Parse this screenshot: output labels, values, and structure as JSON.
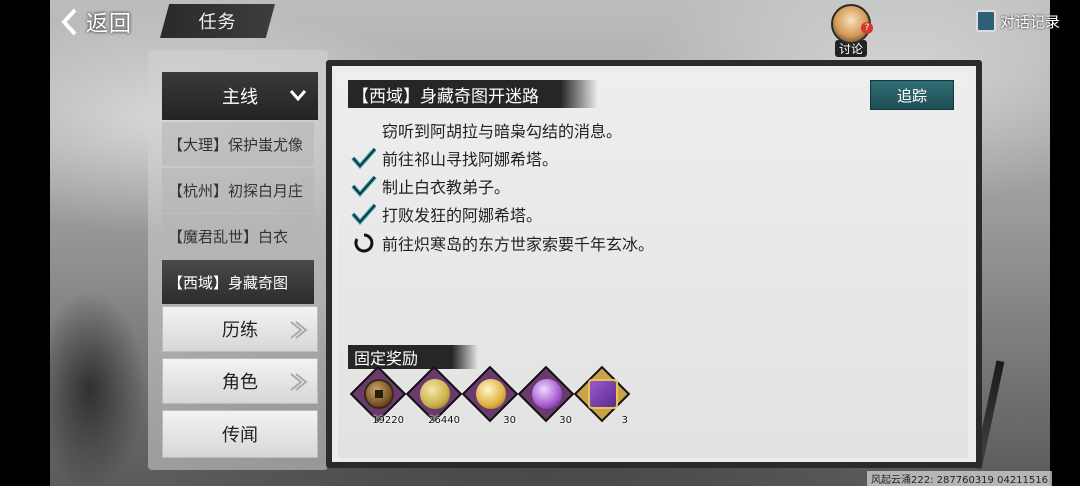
{
  "header": {
    "back_label": "返回",
    "page_title": "任务",
    "discuss_label": "讨论",
    "discuss_badge": "?",
    "dialog_log_label": "对话记录"
  },
  "nav": {
    "main_label": "主线",
    "quests": [
      {
        "label": "【大理】保护蚩尤像",
        "active": false
      },
      {
        "label": "【杭州】初探白月庄",
        "active": false
      },
      {
        "label": "【魔君乱世】白衣",
        "active": false
      },
      {
        "label": "【西域】身藏奇图",
        "active": true
      }
    ],
    "categories": [
      {
        "label": "历练"
      },
      {
        "label": "角色"
      },
      {
        "label": "传闻"
      }
    ]
  },
  "quest": {
    "title": "【西域】身藏奇图开迷路",
    "track_label": "追踪",
    "description": "窃听到阿胡拉与暗枭勾结的消息。",
    "tasks": [
      {
        "text": "前往祁山寻找阿娜希塔。",
        "status": "done"
      },
      {
        "text": "制止白衣教弟子。",
        "status": "done"
      },
      {
        "text": "打败发狂的阿娜希塔。",
        "status": "done"
      },
      {
        "text": "前往炽寒岛的东方世家索要千年玄冰。",
        "status": "in-progress"
      }
    ]
  },
  "rewards": {
    "title": "固定奖励",
    "items": [
      {
        "icon": "coin-icon",
        "count": "19220",
        "color": "#7a5a32"
      },
      {
        "icon": "silver-icon",
        "count": "26440",
        "color": "#c9b04a"
      },
      {
        "icon": "gold-orb-icon",
        "count": "30",
        "color": "#e0b040"
      },
      {
        "icon": "purple-orb-icon",
        "count": "30",
        "color": "#a65bd0"
      },
      {
        "icon": "gift-box-icon",
        "count": "3",
        "color": "#7b3fa8"
      }
    ]
  },
  "footer": {
    "id_text": "风起云涌222: 287760319  04211516"
  },
  "colors": {
    "accent_teal": "#2e6e74",
    "dark_banner": "#262626",
    "check_teal": "#2a8fa0"
  }
}
